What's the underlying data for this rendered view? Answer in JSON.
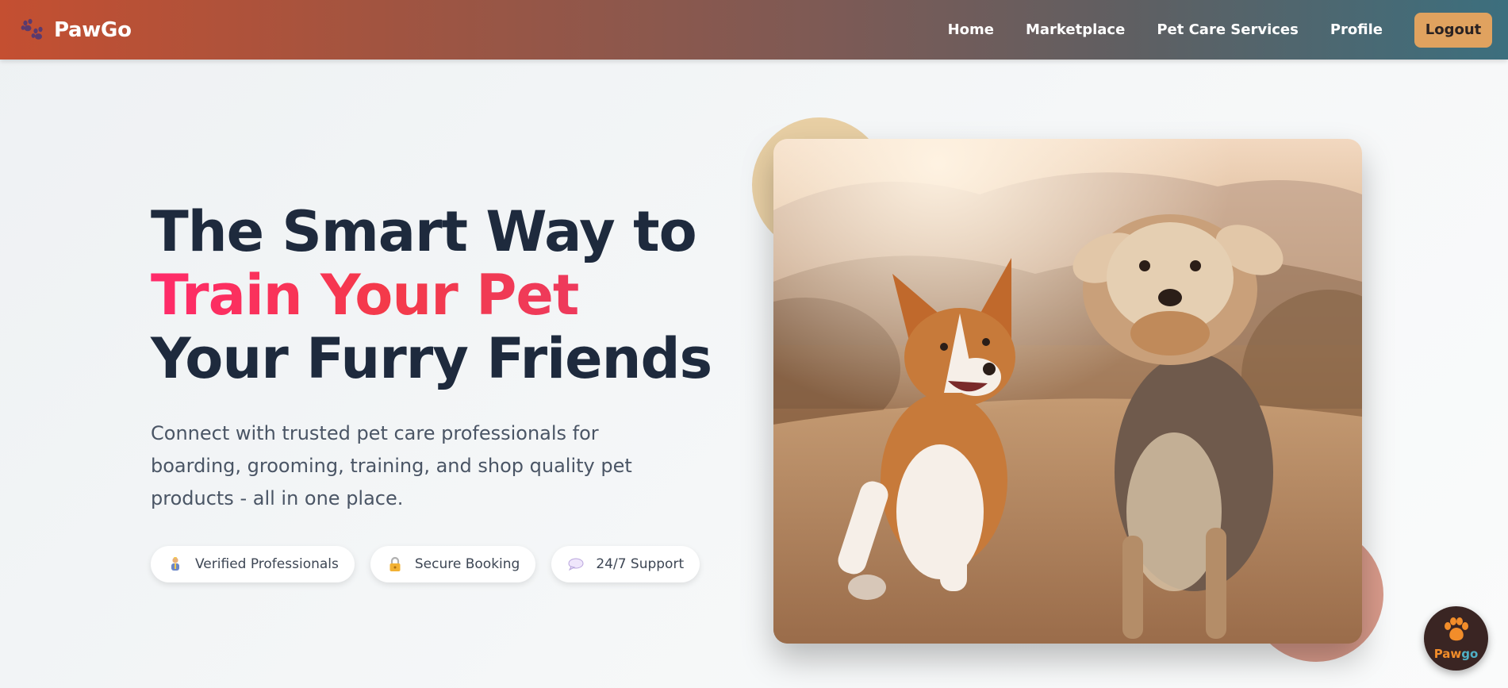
{
  "brand": {
    "name": "PawGo",
    "icon": "paw-prints-icon"
  },
  "nav": {
    "links": [
      {
        "label": "Home"
      },
      {
        "label": "Marketplace"
      },
      {
        "label": "Pet Care Services"
      },
      {
        "label": "Profile"
      }
    ],
    "logout_label": "Logout"
  },
  "hero": {
    "title_line1": "The Smart Way to",
    "title_line2": "Train Your Pet",
    "title_line3": "Your Furry Friends",
    "subtitle": "Connect with trusted pet care professionals for boarding, grooming, training, and shop quality pet products - all in one place.",
    "features": [
      {
        "label": "Verified Professionals",
        "icon": "professional-person-icon"
      },
      {
        "label": "Secure Booking",
        "icon": "lock-icon"
      },
      {
        "label": "24/7 Support",
        "icon": "speech-bubble-icon"
      }
    ],
    "image": {
      "subject": "two dogs walking on a dirt path"
    }
  },
  "floating_badge": {
    "label_part1": "Paw",
    "label_part2": "go",
    "icon": "paw-icon"
  },
  "colors": {
    "accent_pink": "#ff2a6a",
    "logout_bg": "#e0a25f",
    "title_dark": "#1e2a3d"
  }
}
